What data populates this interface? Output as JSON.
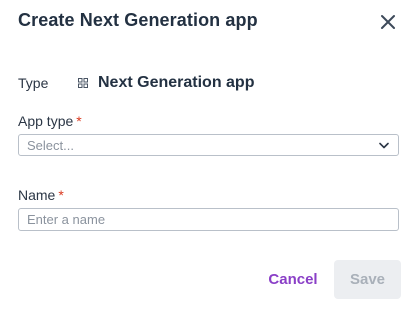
{
  "dialog": {
    "title": "Create Next Generation app",
    "close_icon": "close-icon"
  },
  "type_row": {
    "label": "Type",
    "icon": "app-grid-icon",
    "value": "Next Generation app"
  },
  "app_type": {
    "label": "App type",
    "required_mark": "*",
    "placeholder": "Select...",
    "chevron_icon": "chevron-down-icon"
  },
  "name": {
    "label": "Name",
    "required_mark": "*",
    "placeholder": "Enter a name",
    "value": ""
  },
  "actions": {
    "cancel_label": "Cancel",
    "save_label": "Save"
  },
  "colors": {
    "accent": "#8a3fc7",
    "required": "#d9381e",
    "disabled_bg": "#eceef1",
    "disabled_text": "#a9b0b9"
  }
}
